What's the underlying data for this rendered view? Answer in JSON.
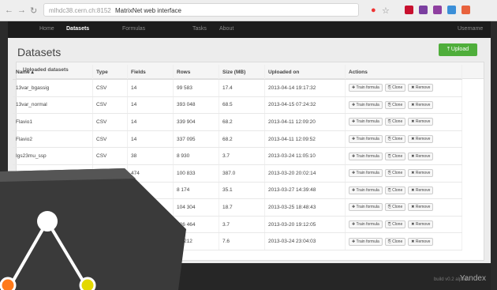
{
  "browser": {
    "url": "mlhdc38.cern.ch:8152",
    "tab_title": "MatrixNet web interface"
  },
  "navbar": {
    "items": [
      "Home",
      "Datasets",
      "Formulas",
      "Tasks",
      "About"
    ],
    "user": "Username"
  },
  "page": {
    "title": "Datasets",
    "upload_label": "Upload",
    "section_title": "Uploaded datasets"
  },
  "table": {
    "columns": [
      "Name",
      "Type",
      "Fields",
      "Rows",
      "Size (MB)",
      "Uploaded on",
      "Actions"
    ],
    "rows": [
      [
        "13var_bgassig",
        "CSV",
        "14",
        "99 583",
        "17.4",
        "2013-04-14 19:17:32"
      ],
      [
        "13var_normal",
        "CSV",
        "14",
        "393 048",
        "68.5",
        "2013-04-15 07:24:32"
      ],
      [
        "Flavio1",
        "CSV",
        "14",
        "339 904",
        "68.2",
        "2013-04-11 12:09:20"
      ],
      [
        "Flavio2",
        "CSV",
        "14",
        "337 095",
        "68.2",
        "2013-04-11 12:09:52"
      ],
      [
        "Igs23mu_ssp",
        "CSV",
        "38",
        "8 930",
        "3.7",
        "2013-03-24 11:05:10"
      ],
      [
        "",
        "",
        "474",
        "100 833",
        "387.0",
        "2013-03-20 20:02:14"
      ],
      [
        "",
        "",
        "498",
        "8 174",
        "35.1",
        "2013-03-27 14:39:48"
      ],
      [
        "",
        "",
        "33",
        "104 304",
        "18.7",
        "2013-03-25 18:48:43"
      ],
      [
        "",
        "",
        "",
        "126 464",
        "3.7",
        "2013-03-20 19:12:05"
      ],
      [
        "",
        "",
        "",
        "84 212",
        "7.6",
        "2013-03-24 23:04:03"
      ]
    ],
    "actions": [
      "Train formula",
      "Clone",
      "Remove"
    ]
  },
  "footer": {
    "build": "build v0.2 alpha",
    "brand": "Yandex"
  }
}
